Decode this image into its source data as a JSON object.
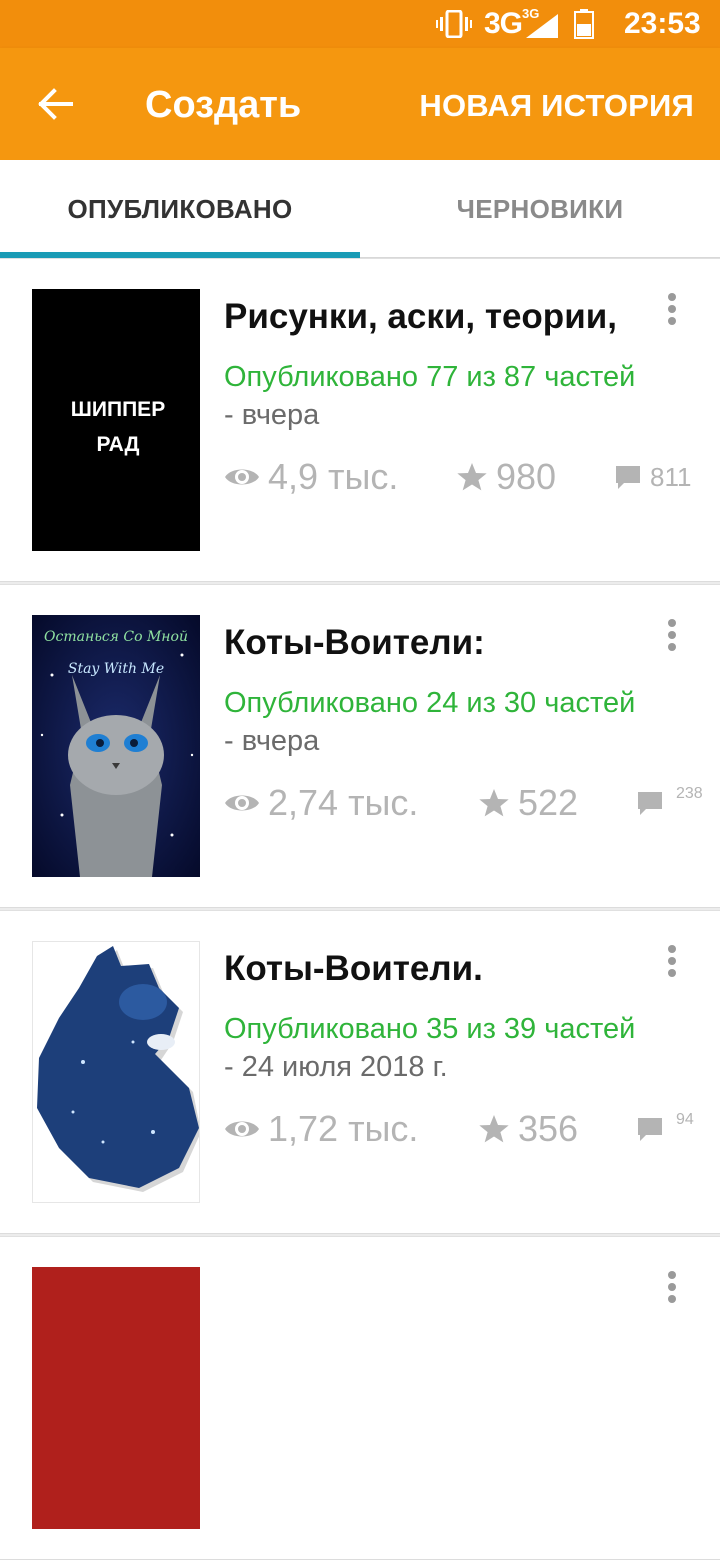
{
  "status_bar": {
    "network": "3G",
    "network_small": "3G",
    "time": "23:53",
    "icons": [
      "vibrate-icon",
      "signal-icon",
      "battery-icon"
    ]
  },
  "app_bar": {
    "title": "Создать",
    "action": "НОВАЯ ИСТОРИЯ",
    "back_icon": "arrow-left-icon"
  },
  "tabs": [
    {
      "label": "ОПУБЛИКОВАНО",
      "active": true
    },
    {
      "label": "ЧЕРНОВИКИ",
      "active": false
    }
  ],
  "colors": {
    "status_bar": "#f28e0c",
    "app_bar": "#f5970f",
    "tab_indicator": "#1a9bb5",
    "published_text": "#2fb43a",
    "stat_text": "#b4b4b4"
  },
  "stories": [
    {
      "title": "Рисунки, аски, теории,",
      "published": "Опубликовано 77 из 87 частей",
      "updated": "- вчера",
      "views": "4,9 тыс.",
      "votes": "980",
      "comments": "811",
      "cover_text": [
        "ШИППЕР",
        "РАД"
      ]
    },
    {
      "title": "Коты-Воители:",
      "published": "Опубликовано 24 из 30 частей",
      "updated": "- вчера",
      "views": "2,74 тыс.",
      "votes": "522",
      "comments": "238",
      "cover_text": [
        "Останься Со Мной",
        "Stay With Me"
      ]
    },
    {
      "title": "Коты-Воители.",
      "published": "Опубликовано 35 из 39 частей",
      "updated": "- 24 июля 2018 г.",
      "views": "1,72 тыс.",
      "votes": "356",
      "comments": "94"
    }
  ]
}
